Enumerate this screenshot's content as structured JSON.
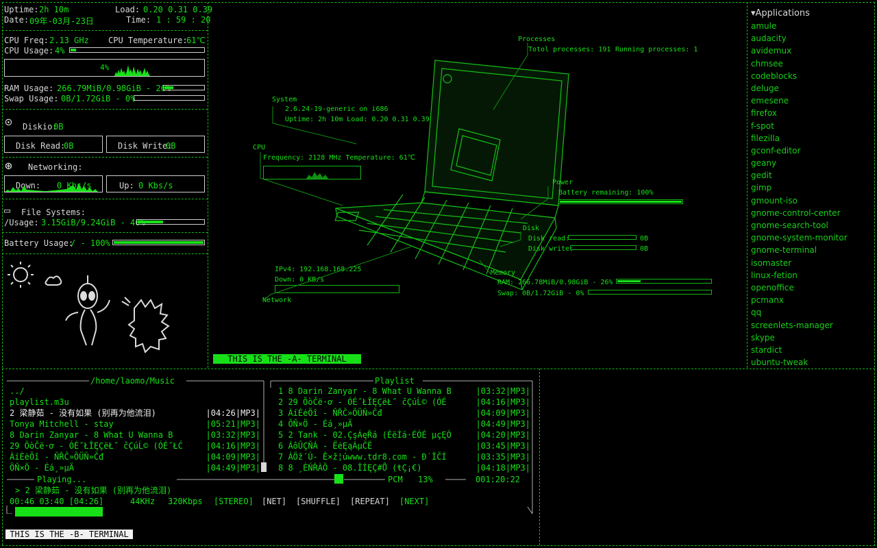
{
  "conky": {
    "uptime_label": "Uptime:",
    "uptime": "2h 10m",
    "load_label": "Load:",
    "load": "0.20 0.31 0.39",
    "date_label": "Date:",
    "date": "09年-03月-23日",
    "time_label": "Time:",
    "time": "1 : 59 : 20",
    "cpu_freq_label": "CPU Freq:",
    "cpu_freq": "2.13 GHz",
    "cpu_temp_label": "CPU Temperature:",
    "cpu_temp": "61℃",
    "cpu_usage_label": "CPU Usage:",
    "cpu_usage": "4%",
    "cpu_graph_label": "4%",
    "ram_label": "RAM Usage:",
    "ram": "266.79MiB/0.98GiB - 26%",
    "ram_fill": 0.26,
    "swap_label": "Swap Usage:",
    "swap": "0B/1.72GiB - 0%",
    "swap_fill": 0.0,
    "diskio_label": "Diskio:",
    "diskio": "0B",
    "disk_read_label": "Disk Read:",
    "disk_read": "0B",
    "disk_write_label": "Disk Write:",
    "disk_write": "0B",
    "net_label": "Networking:",
    "down_label": "Down:",
    "down": "0 Kbs/s",
    "up_label": "Up:",
    "up": "0 Kbs/s",
    "fs_label": "File Systems:",
    "fs_root_label": "/Usage:",
    "fs_root": "3.15GiB/9.24GiB - 40%",
    "fs_fill": 0.4,
    "battery_label": "Battery Usage:",
    "battery": "/ - 100%",
    "battery_fill": 1.0
  },
  "hud": {
    "processes_title": "Processes",
    "total_proc": "Totol processes: 191",
    "running_proc": "Running processes: 1",
    "system_title": "System",
    "kernel": "2.6.24-19-generic on i686",
    "uptime_load": "Uptime: 2h 10m Load: 0.20 0.31 0.39",
    "cpu_title": "CPU",
    "cpu_info": "Frequency: 2128 MHz Temperature: 61℃",
    "power_title": "Power",
    "battery_remaining": "Battery remaining: 100%",
    "battery_fill": 1.0,
    "disk_title": "Disk",
    "disk_read_label": "Disk read:",
    "disk_read": "0B",
    "disk_write_label": "Disk write:",
    "disk_write": "0B",
    "ipv4": "IPv4: 192.168.168.225",
    "down": "Down: 0 KB/s",
    "network_title": "Network",
    "memory_title": "Memory",
    "ram": "RAM: 266.78MiB/0.98GiB - 26%",
    "ram_fill": 0.26,
    "swap": "Swap: 0B/1.72GiB - 0%",
    "swap_fill": 0.0
  },
  "terminal_a_label": "THIS IS THE -A- TERMINAL",
  "terminal_b_label": "THIS IS THE -B- TERMINAL",
  "applications": {
    "header": "▾Applications",
    "items": [
      "amule",
      "audacity",
      "avidemux",
      "chmsee",
      "codeblocks",
      "deluge",
      "emesene",
      "firefox",
      "f-spot",
      "filezilla",
      "gconf-editor",
      "geany",
      "gedit",
      "gimp",
      "gmount-iso",
      "gnome-control-center",
      "gnome-search-tool",
      "gnome-system-monitor",
      "gnome-terminal",
      "isomaster",
      "linux-fetion",
      "openoffice",
      "pcmanx",
      "qq",
      "screenlets-manager",
      "skype",
      "stardict",
      "ubuntu-tweak"
    ]
  },
  "music": {
    "browser_title": "/home/laomo/Music",
    "browser_items": [
      {
        "name": "../",
        "len": ""
      },
      {
        "name": "playlist.m3u",
        "len": ""
      },
      {
        "name": "2 梁静茹 - 没有如果 (别再为他流泪)",
        "len": "|04:26|MP3|"
      },
      {
        "name": "Tonya Mitchell - stay",
        "len": "|05:21|MP3|"
      },
      {
        "name": "8 Darin Zanyar - 8 What U Wanna B",
        "len": "|03:32|MP3|"
      },
      {
        "name": "29 ÕòČë·ơ - ÓÉ˝ŁÎĘÇëŁ˝ ĉÇúĹ© (ÓÉ˝ŁĆ",
        "len": "|04:16|MP3|"
      },
      {
        "name": "ÀíĖėÕî - ŇŘČ»ÕÜŇ»Čđ",
        "len": "|04:09|MP3|"
      },
      {
        "name": "ÖŇ×Ö - Éá¸»µÄ",
        "len": "|04:49|MP3|"
      }
    ],
    "playlist_title": "Playlist",
    "playlist_items": [
      {
        "name": "1 8 Darin Zanyar - 8 What U Wanna B",
        "len": "|03:32|MP3|"
      },
      {
        "name": "2 29 ÕòČë·ơ - ÓÉ˝ŁÎĘÇëŁ˝ ĉÇúĹ© (ÓÉ",
        "len": "|04:16|MP3|"
      },
      {
        "name": "3 ÀíĖėÕî - ŇŘČ»ÕÜŇ»Čđ",
        "len": "|04:09|MP3|"
      },
      {
        "name": "4 ÕŇ×Ö - Éá¸»µÄ",
        "len": "|04:49|MP3|"
      },
      {
        "name": "5 2 Tank - 02.ÇşÁęŘá (ĖëÍá·ÉÓÉ µçĘÓ",
        "len": "|04:20|MP3|"
      },
      {
        "name": "6 ÁôÛÇŇÁ - ËėĘąÁµČË",
        "len": "|03:45|MP3|"
      },
      {
        "name": "7 ÁÖž´Ù- Ê×ž¦úwww.tdr8.com - Ð˙ÎČÍ",
        "len": "|03:35|MP3|"
      },
      {
        "name": "8 8 ¸ÈŃŘÀÕ - 08.ÎÍĘÇ#Ů (ŧÇ¡€)",
        "len": "|04:18|MP3|"
      }
    ],
    "mixer_label": "PCM",
    "mixer_value": "13%",
    "total_time": "001:20:22",
    "playing_title": "Playing...",
    "now_playing": "> 2 梁静茹 - 没有如果 (别再为他流泪)",
    "status_times": "00:46 03:40 [04:26]",
    "freq": "44KHz",
    "bitrate": "320Kbps",
    "stereo": "[STEREO]",
    "net": "[NET]",
    "shuffle": "[SHUFFLE]",
    "repeat": "[REPEAT]",
    "next": "[NEXT]",
    "progress": 0.17
  },
  "colors": {
    "accent": "#18e018",
    "text": "#d8d8d8",
    "bg": "#000000"
  }
}
